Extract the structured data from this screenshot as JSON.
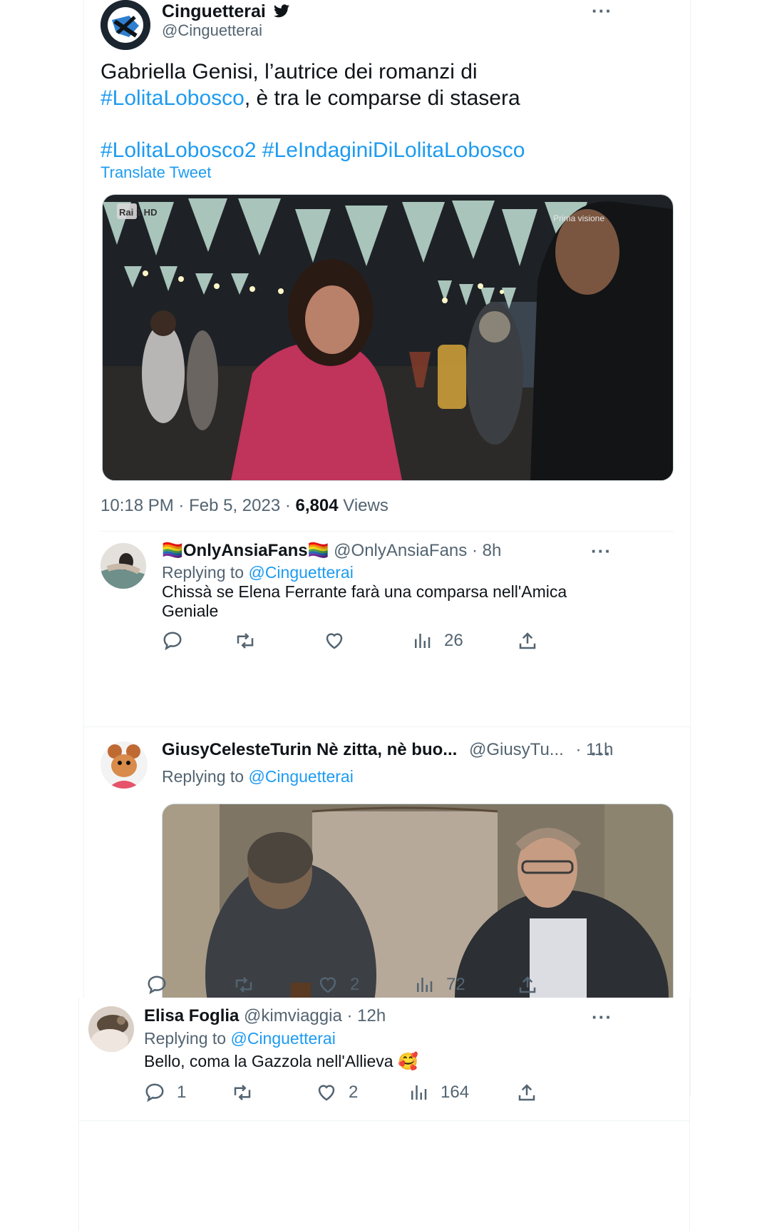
{
  "main_tweet": {
    "author": {
      "name": "Cinguetterai",
      "handle": "@Cinguetterai",
      "badge_icon": "twitter-bird-icon"
    },
    "text": {
      "line1": "Gabriella Genisi, l’autrice dei romanzi di",
      "hashtag1": "#LolitaLobosco",
      "line2_rest": ", è tra le comparse di stasera",
      "hashtag2": "#LolitaLobosco2",
      "hashtag3": "#LeIndaginiDiLolitaLobosco"
    },
    "translate_label": "Translate Tweet",
    "media": {
      "channel_logo": "Rai 1 HD",
      "overlay_text": "Prima visione"
    },
    "time": "10:18 PM",
    "sep1": "·",
    "date": "Feb 5, 2023",
    "sep2": "·",
    "views_count": "6,804",
    "views_label": "Views"
  },
  "replies": [
    {
      "name": "🏳️‍🌈OnlyAnsiaFans🏳️‍🌈",
      "handle": "@OnlyAnsiaFans",
      "time": "· 8h",
      "replying_prefix": "Replying to",
      "replying_to": "@Cinguetterai",
      "text_line1": "Chissà se Elena Ferrante farà una comparsa nell'Amica",
      "text_line2": "Geniale",
      "actions": {
        "reply": "",
        "retweet": "",
        "like": "",
        "views": "26"
      }
    },
    {
      "name": "GiusyCelesteTurin Nè zitta, nè buo...",
      "handle": "@GiusyTu...",
      "time": "· 11h",
      "replying_prefix": "Replying to",
      "replying_to": "@Cinguetterai",
      "actions": {
        "reply": "",
        "retweet": "",
        "like": "2",
        "views": "72"
      }
    },
    {
      "name": "Elisa Foglia",
      "handle": "@kimviaggia",
      "time": "· 12h",
      "replying_prefix": "Replying to",
      "replying_to": "@Cinguetterai",
      "text": "Bello, coma la Gazzola nell'Allieva 🥰",
      "actions": {
        "reply": "1",
        "retweet": "",
        "like": "2",
        "views": "164"
      }
    }
  ],
  "colors": {
    "link": "#1d9bf0",
    "muted": "#536471",
    "text": "#0f1419",
    "border": "#eff3f4"
  }
}
